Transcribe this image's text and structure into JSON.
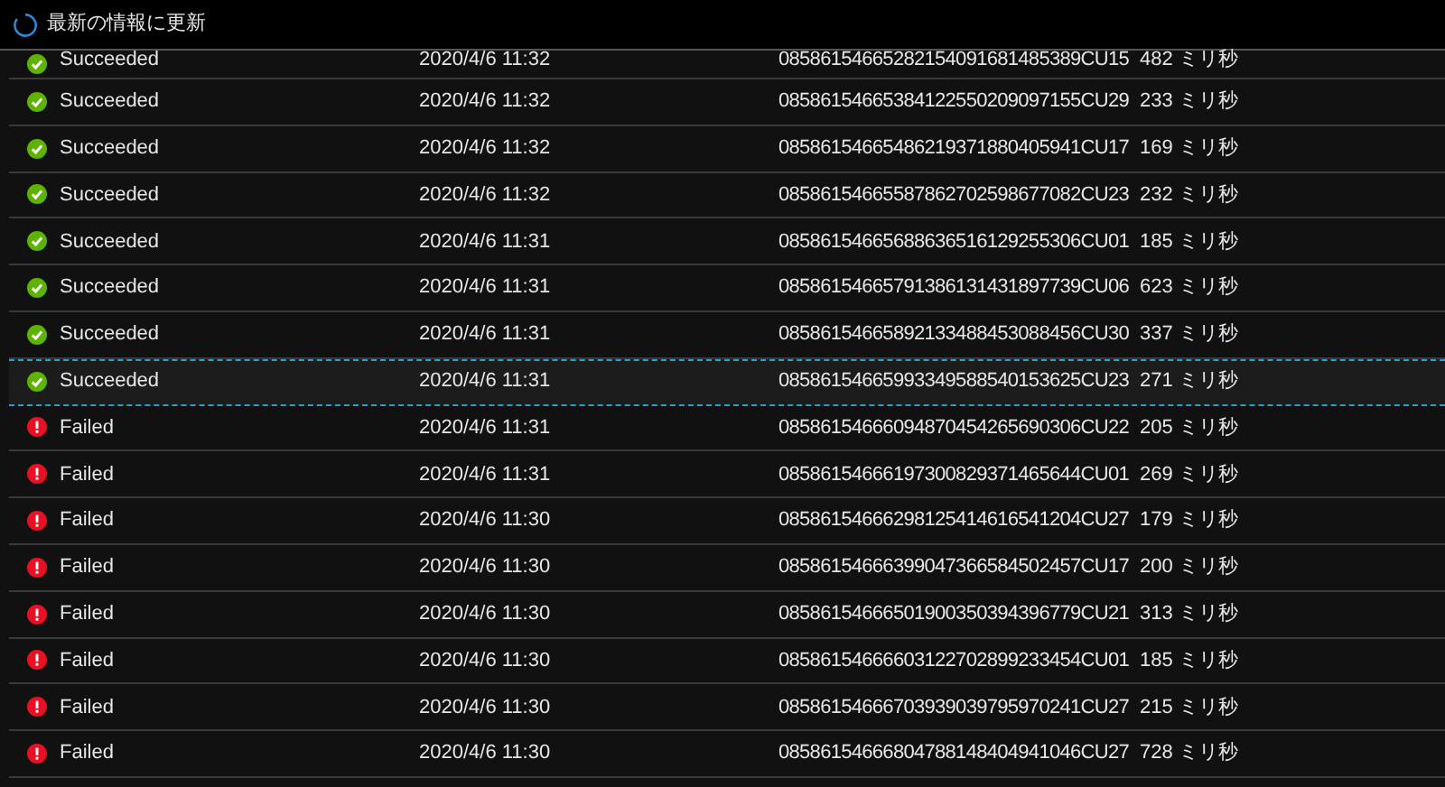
{
  "toolbar": {
    "refresh_label": "最新の情報に更新"
  },
  "rows": [
    {
      "kind": "succeeded",
      "label": "Succeeded",
      "time": "2020/4/6 11:32",
      "run_id": "08586154665282154091681485389CU15",
      "duration": "482 ミリ秒",
      "selected": false
    },
    {
      "kind": "succeeded",
      "label": "Succeeded",
      "time": "2020/4/6 11:32",
      "run_id": "08586154665384122550209097155CU29",
      "duration": "233 ミリ秒",
      "selected": false
    },
    {
      "kind": "succeeded",
      "label": "Succeeded",
      "time": "2020/4/6 11:32",
      "run_id": "08586154665486219371880405941CU17",
      "duration": "169 ミリ秒",
      "selected": false
    },
    {
      "kind": "succeeded",
      "label": "Succeeded",
      "time": "2020/4/6 11:32",
      "run_id": "08586154665587862702598677082CU23",
      "duration": "232 ミリ秒",
      "selected": false
    },
    {
      "kind": "succeeded",
      "label": "Succeeded",
      "time": "2020/4/6 11:31",
      "run_id": "08586154665688636516129255306CU01",
      "duration": "185 ミリ秒",
      "selected": false
    },
    {
      "kind": "succeeded",
      "label": "Succeeded",
      "time": "2020/4/6 11:31",
      "run_id": "08586154665791386131431897739CU06",
      "duration": "623 ミリ秒",
      "selected": false
    },
    {
      "kind": "succeeded",
      "label": "Succeeded",
      "time": "2020/4/6 11:31",
      "run_id": "08586154665892133488453088456CU30",
      "duration": "337 ミリ秒",
      "selected": false
    },
    {
      "kind": "succeeded",
      "label": "Succeeded",
      "time": "2020/4/6 11:31",
      "run_id": "08586154665993349588540153625CU23",
      "duration": "271 ミリ秒",
      "selected": true
    },
    {
      "kind": "failed",
      "label": "Failed",
      "time": "2020/4/6 11:31",
      "run_id": "08586154666094870454265690306CU22",
      "duration": "205 ミリ秒",
      "selected": false
    },
    {
      "kind": "failed",
      "label": "Failed",
      "time": "2020/4/6 11:31",
      "run_id": "08586154666197300829371465644CU01",
      "duration": "269 ミリ秒",
      "selected": false
    },
    {
      "kind": "failed",
      "label": "Failed",
      "time": "2020/4/6 11:30",
      "run_id": "08586154666298125414616541204CU27",
      "duration": "179 ミリ秒",
      "selected": false
    },
    {
      "kind": "failed",
      "label": "Failed",
      "time": "2020/4/6 11:30",
      "run_id": "08586154666399047366584502457CU17",
      "duration": "200 ミリ秒",
      "selected": false
    },
    {
      "kind": "failed",
      "label": "Failed",
      "time": "2020/4/6 11:30",
      "run_id": "08586154666501900350394396779CU21",
      "duration": "313 ミリ秒",
      "selected": false
    },
    {
      "kind": "failed",
      "label": "Failed",
      "time": "2020/4/6 11:30",
      "run_id": "08586154666603122702899233454CU01",
      "duration": "185 ミリ秒",
      "selected": false
    },
    {
      "kind": "failed",
      "label": "Failed",
      "time": "2020/4/6 11:30",
      "run_id": "08586154666703939039795970241CU27",
      "duration": "215 ミリ秒",
      "selected": false
    },
    {
      "kind": "failed",
      "label": "Failed",
      "time": "2020/4/6 11:30",
      "run_id": "08586154666804788148404941046CU27",
      "duration": "728 ミリ秒",
      "selected": false
    }
  ]
}
